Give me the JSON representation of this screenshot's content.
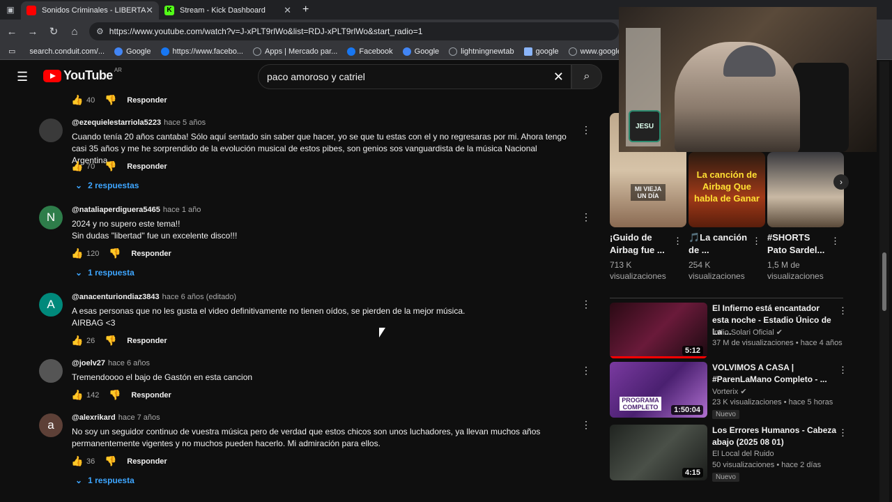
{
  "browser": {
    "tabs": [
      {
        "title": "Sonidos Criminales - LIBERTAD - /",
        "active": true,
        "favicon_color": "#ff0000"
      },
      {
        "title": "Stream - Kick Dashboard",
        "active": false,
        "favicon_color": "#53fc18"
      }
    ],
    "new_tab_label": "+",
    "url": "https://www.youtube.com/watch?v=J-xPLT9rlWo&list=RDJ-xPLT9rlWo&start_radio=1",
    "bookmarks": [
      {
        "label": "search.conduit.com/...",
        "color": "#888888"
      },
      {
        "label": "Google",
        "color": "#4285f4"
      },
      {
        "label": "https://www.facebo...",
        "color": "#1877f2"
      },
      {
        "label": "Apps | Mercado par...",
        "color": "#9aa0a6"
      },
      {
        "label": "Facebook",
        "color": "#1877f2"
      },
      {
        "label": "Google",
        "color": "#4285f4"
      },
      {
        "label": "lightningnewtab",
        "color": "#9aa0a6"
      },
      {
        "label": "google",
        "color": "#8ab4f8"
      },
      {
        "label": "www.google.com",
        "color": "#9aa0a6"
      }
    ]
  },
  "youtube": {
    "logo_text": "YouTube",
    "country_code": "AR",
    "search_value": "paco amoroso y catriel"
  },
  "comments": {
    "top_actions": {
      "likes": "40",
      "reply_label": "Responder"
    },
    "items": [
      {
        "author": "@ezequielestarriola5223",
        "time": "hace 5 años",
        "text": "Cuando tenía 20 años cantaba! Sólo aquí sentado sin saber que hacer, yo se que tu estas con el y no regresaras por mi. Ahora tengo casi 35 años y me he sorprendido de la evolución musical de estos pibes, son genios sos vanguardista de la música Nacional Argentina.",
        "likes": "70",
        "reply_label": "Responder",
        "replies": "2 respuestas",
        "avatar_letter": "",
        "avatar_color": "#3a3a3a"
      },
      {
        "author": "@nataliaperdiguera5465",
        "time": "hace 1 año",
        "text": "2024 y no supero este tema!!",
        "text2": "Sin dudas \"libertad\" fue un excelente disco!!!",
        "likes": "120",
        "reply_label": "Responder",
        "replies": "1 respuesta",
        "avatar_letter": "N",
        "avatar_color": "#2e7d4a"
      },
      {
        "author": "@anacenturiondiaz3843",
        "time": "hace 6 años (editado)",
        "text": "A esas personas que no les gusta el video definitivamente no tienen oídos, se pierden de la mejor música.",
        "text2": "AIRBAG <3",
        "likes": "26",
        "reply_label": "Responder",
        "avatar_letter": "A",
        "avatar_color": "#00897b"
      },
      {
        "author": "@joelv27",
        "time": "hace 6 años",
        "text": "Tremendoooo el bajo de Gastón en esta cancion",
        "likes": "142",
        "reply_label": "Responder",
        "avatar_letter": "",
        "avatar_color": "#555555"
      },
      {
        "author": "@alexrikard",
        "time": "hace 7 años",
        "text": "No soy un seguidor continuo de vuestra música pero de verdad que estos chicos son unos luchadores, ya llevan muchos años permanentemente vigentes y no muchos pueden hacerlo. Mi admiración para ellos.",
        "likes": "36",
        "reply_label": "Responder",
        "replies": "1 respuesta",
        "avatar_letter": "a",
        "avatar_color": "#5d4037"
      }
    ]
  },
  "shorts": [
    {
      "title": "¡Guido de Airbag fue ...",
      "views": "713 K visualizaciones",
      "overlay": "MI VIEJA UN DÍA"
    },
    {
      "title": "🎵La canción de ...",
      "views": "254 K visualizaciones",
      "overlay": "La canción de Airbag Que habla de Ganar"
    },
    {
      "title": "#SHORTS Pato Sardel...",
      "views": "1,5 M de visualizaciones",
      "overlay": ""
    }
  ],
  "videos": [
    {
      "title": "El Infierno está encantador esta noche - Estadio Único de La ...",
      "channel": "Indio Solari Oficial",
      "meta": "37 M de visualizaciones • hace 4 años",
      "duration": "5:12",
      "badge": ""
    },
    {
      "title": "VOLVIMOS A CASA | #ParenLaMano Completo - ...",
      "channel": "Vorterix",
      "meta": "23 K visualizaciones • hace 5 horas",
      "duration": "1:50:04",
      "badge": "Nuevo",
      "overlay": "PROGRAMA COMPLETO"
    },
    {
      "title": "Los Errores Humanos - Cabeza abajo (2025 08 01)",
      "channel": "El Local del Ruido",
      "meta": "50 visualizaciones • hace 2 días",
      "duration": "4:15",
      "badge": "Nuevo"
    }
  ],
  "webcam": {
    "logo": "JESU"
  }
}
